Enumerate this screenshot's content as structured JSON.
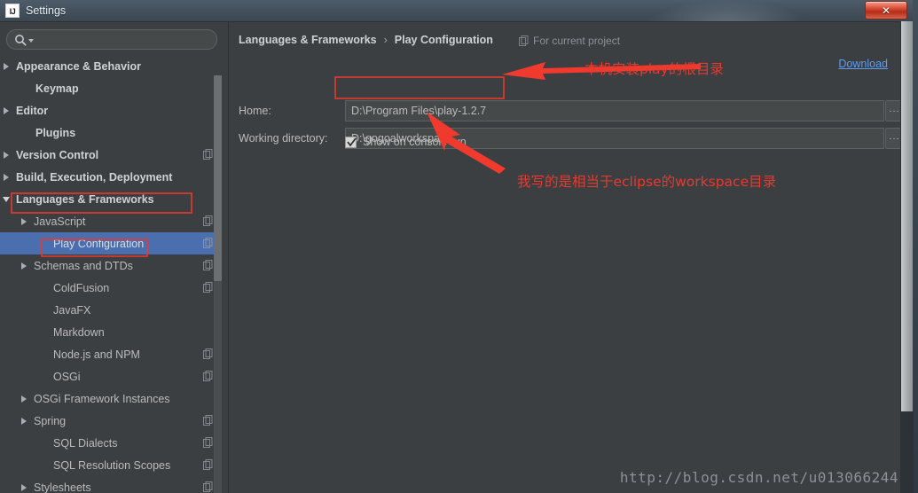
{
  "window": {
    "title": "Settings",
    "logo_text": "IJ",
    "close_label": "✕"
  },
  "sidebar": {
    "search": {
      "placeholder": "",
      "value": ""
    },
    "items": [
      {
        "label": "Appearance & Behavior",
        "twisty": "right",
        "indent": 8,
        "bold": true,
        "badge": false,
        "selected": false
      },
      {
        "label": "Keymap",
        "twisty": "none",
        "indent": 30,
        "bold": true,
        "badge": false,
        "selected": false
      },
      {
        "label": "Editor",
        "twisty": "right",
        "indent": 8,
        "bold": true,
        "badge": false,
        "selected": false
      },
      {
        "label": "Plugins",
        "twisty": "none",
        "indent": 30,
        "bold": true,
        "badge": false,
        "selected": false
      },
      {
        "label": "Version Control",
        "twisty": "right",
        "indent": 8,
        "bold": true,
        "badge": true,
        "selected": false
      },
      {
        "label": "Build, Execution, Deployment",
        "twisty": "right",
        "indent": 8,
        "bold": true,
        "badge": false,
        "selected": false
      },
      {
        "label": "Languages & Frameworks",
        "twisty": "down",
        "indent": 8,
        "bold": true,
        "badge": false,
        "selected": false
      },
      {
        "label": "JavaScript",
        "twisty": "right",
        "indent": 28,
        "bold": false,
        "badge": true,
        "selected": false
      },
      {
        "label": "Play Configuration",
        "twisty": "none",
        "indent": 50,
        "bold": false,
        "badge": true,
        "selected": true
      },
      {
        "label": "Schemas and DTDs",
        "twisty": "right",
        "indent": 28,
        "bold": false,
        "badge": true,
        "selected": false
      },
      {
        "label": "ColdFusion",
        "twisty": "none",
        "indent": 50,
        "bold": false,
        "badge": true,
        "selected": false
      },
      {
        "label": "JavaFX",
        "twisty": "none",
        "indent": 50,
        "bold": false,
        "badge": false,
        "selected": false
      },
      {
        "label": "Markdown",
        "twisty": "none",
        "indent": 50,
        "bold": false,
        "badge": false,
        "selected": false
      },
      {
        "label": "Node.js and NPM",
        "twisty": "none",
        "indent": 50,
        "bold": false,
        "badge": true,
        "selected": false
      },
      {
        "label": "OSGi",
        "twisty": "none",
        "indent": 50,
        "bold": false,
        "badge": true,
        "selected": false
      },
      {
        "label": "OSGi Framework Instances",
        "twisty": "right",
        "indent": 28,
        "bold": false,
        "badge": false,
        "selected": false
      },
      {
        "label": "Spring",
        "twisty": "right",
        "indent": 28,
        "bold": false,
        "badge": true,
        "selected": false
      },
      {
        "label": "SQL Dialects",
        "twisty": "none",
        "indent": 50,
        "bold": false,
        "badge": true,
        "selected": false
      },
      {
        "label": "SQL Resolution Scopes",
        "twisty": "none",
        "indent": 50,
        "bold": false,
        "badge": true,
        "selected": false
      },
      {
        "label": "Stylesheets",
        "twisty": "right",
        "indent": 28,
        "bold": false,
        "badge": true,
        "selected": false
      }
    ]
  },
  "content": {
    "breadcrumb": {
      "parent": "Languages & Frameworks",
      "separator": "›",
      "current": "Play Configuration"
    },
    "scope_note": "For current project",
    "download_label": "Download",
    "fields": [
      {
        "label": "Home:",
        "value": "D:\\Program Files\\play-1.2.7",
        "browse": "..."
      },
      {
        "label": "Working directory:",
        "value": "D:\\gogoalworkspack",
        "browse": "..."
      }
    ],
    "checkbox": {
      "label": "Show on console run",
      "checked": true
    }
  },
  "annotations": [
    {
      "text": "本机安装play的根目录"
    },
    {
      "text": "我写的是相当于eclipse的workspace目录"
    }
  ],
  "watermark": "http://blog.csdn.net/u013066244",
  "colors": {
    "accent_selection": "#4b6eaf",
    "annotation_red": "#e8392e",
    "link_blue": "#589df6",
    "panel_bg": "#3c3f41",
    "field_bg": "#45494a"
  }
}
